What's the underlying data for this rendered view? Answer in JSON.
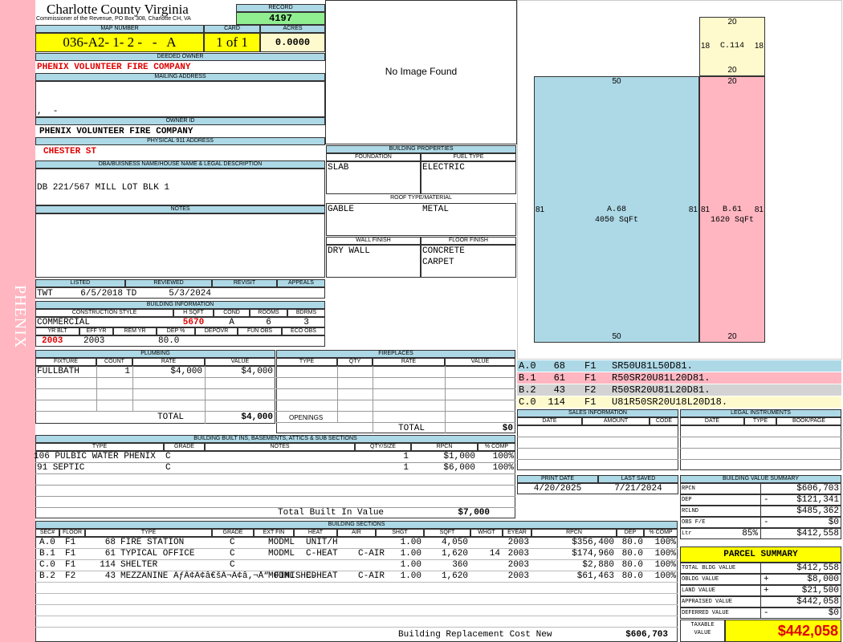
{
  "sidebar": {
    "label": "PHENIX"
  },
  "header": {
    "county": "Charlotte County Virginia",
    "commissioner": "Commissioner of the Revenue, PO Box 308, Charlotte CH, VA",
    "record_label": "RECORD",
    "record": "4197"
  },
  "parcel": {
    "map_label": "MAP NUMBER",
    "map_number": "036-A2- 1- 2 -   -   A",
    "card_label": "CARD",
    "card": "1 of 1",
    "acres_label": "ACRES",
    "acres": "0.0000",
    "deeded_label": "DEEDED OWNER",
    "deeded_owner": "PHENIX VOLUNTEER FIRE COMPANY",
    "mailing_label": "MAILING ADDRESS",
    "mailing_line": ",  -",
    "owner_id_label": "OWNER ID",
    "owner_id": "PHENIX VOLUNTEER FIRE COMPANY",
    "physical_label": "PHYSICAL 911 ADDRESS",
    "physical": "CHESTER ST",
    "dba_label": "DBA/BUISNESS NAME/HOUSE NAME & LEGAL DESCRIPTION",
    "legal": "DB 221/567 MILL LOT BLK 1",
    "notes_label": "NOTES"
  },
  "image": {
    "no_image": "No Image Found"
  },
  "listing": {
    "listed_label": "LISTED",
    "listed_by": "TWT",
    "listed_date": "6/5/2018",
    "reviewed_label": "REVIEWED",
    "reviewed_by": "TD",
    "reviewed_date": "5/3/2024",
    "revisit_label": "REVISIT",
    "appeals_label": "APPEALS"
  },
  "bldg_info": {
    "title": "BUILDING INFORMATION",
    "construction_label": "CONSTRUCTION STYLE",
    "hsqft_label": "H SQFT",
    "cond_label": "COND",
    "rooms_label": "ROOMS",
    "bdrms_label": "BDRMS",
    "construction": "COMMERCIAL",
    "hsqft": "5670",
    "cond": "A",
    "rooms": "6",
    "bdrms": "3",
    "yrblt_label": "YR BLT",
    "effyr_label": "EFF YR",
    "remyr_label": "REM YR",
    "dep_label": "DEP %",
    "depovr_label": "DEPOVR",
    "funobs_label": "FUN OBS",
    "ecoobs_label": "ECO OBS",
    "yrblt": "2003",
    "effyr": "2003",
    "dep": "80.0"
  },
  "props": {
    "title": "BUILDING PROPERTIES",
    "foundation_label": "FOUNDATION",
    "fuel_label": "FUEL TYPE",
    "foundation": "SLAB",
    "fuel": "ELECTRIC",
    "roof_label": "ROOF TYPE/MATERIAL",
    "roof_type": "GABLE",
    "roof_material": "METAL",
    "wall_label": "WALL FINISH",
    "floor_label": "FLOOR FINISH",
    "wall": "DRY WALL",
    "floor1": "CONCRETE",
    "floor2": "CARPET"
  },
  "plumbing": {
    "title": "PLUMBING",
    "fixture_label": "FIXTURE",
    "count_label": "COUNT",
    "rate_label": "RATE",
    "value_label": "VALUE",
    "fixture": "FULLBATH",
    "count": "1",
    "rate": "$4,000",
    "value": "$4,000",
    "total_label": "TOTAL",
    "total": "$4,000"
  },
  "fireplaces": {
    "title": "FIREPLACES",
    "type_label": "TYPE",
    "qty_label": "QTY",
    "rate_label": "RATE",
    "value_label": "VALUE",
    "openings_label": "OPENINGS",
    "total_label": "TOTAL",
    "total": "$0"
  },
  "builtins": {
    "title": "BUILDING BUILT INS, BASEMENTS, ATTICS & SUB SECTIONS",
    "type_label": "TYPE",
    "grade_label": "GRADE",
    "notes_label": "NOTES",
    "qty_label": "QTY/SIZE",
    "rpcn_label": "RPCN",
    "comp_label": "% COMP",
    "rows": [
      {
        "type": "106 PULBIC WATER PHENIX",
        "grade": "C",
        "qty": "1",
        "rpcn": "$1,000",
        "comp": "100%"
      },
      {
        "type": "91 SEPTIC",
        "grade": "C",
        "qty": "1",
        "rpcn": "$6,000",
        "comp": "100%"
      }
    ],
    "total_label": "Total Built In Value",
    "total": "$7,000"
  },
  "sections": {
    "title": "BUILDING SECTIONS",
    "cols": [
      "SEC#",
      "FLOOR",
      "TYPE",
      "GRADE",
      "EXT FIN",
      "HEAT",
      "AIR",
      "SHGT",
      "SQFT",
      "WHGT",
      "EYEAR",
      "RPCN",
      "DEP",
      "% COMP"
    ],
    "rows": [
      {
        "sec": "A.0",
        "floor": "F1",
        "code": "68",
        "type": "FIRE STATION",
        "grade": "C",
        "ext": "MODML",
        "heat": "UNIT/H",
        "air": "",
        "shgt": "1.00",
        "sqft": "4,050",
        "whgt": "",
        "eyear": "2003",
        "rpcn": "$356,400",
        "dep": "80.0",
        "comp": "100%"
      },
      {
        "sec": "B.1",
        "floor": "F1",
        "code": "61",
        "type": "TYPICAL OFFICE",
        "grade": "C",
        "ext": "MODML",
        "heat": "C-HEAT",
        "air": "C-AIR",
        "shgt": "1.00",
        "sqft": "1,620",
        "whgt": "14",
        "eyear": "2003",
        "rpcn": "$174,960",
        "dep": "80.0",
        "comp": "100%"
      },
      {
        "sec": "C.0",
        "floor": "F1",
        "code": "114",
        "type": "SHELTER",
        "grade": "C",
        "ext": "",
        "heat": "",
        "air": "",
        "shgt": "1.00",
        "sqft": "360",
        "whgt": "",
        "eyear": "2003",
        "rpcn": "$2,880",
        "dep": "80.0",
        "comp": "100%"
      },
      {
        "sec": "B.2",
        "floor": "F2",
        "code": "43",
        "type": "MEZZANINE ÃƒÂ¢Ã¢â€šÂ¬Ã¢â‚¬Å“ FINISHED",
        "grade": "",
        "ext": "MODML",
        "heat": "C-HEAT",
        "air": "C-AIR",
        "shgt": "1.00",
        "sqft": "1,620",
        "whgt": "",
        "eyear": "2003",
        "rpcn": "$61,463",
        "dep": "80.0",
        "comp": "100%"
      }
    ],
    "total_label": "Building Replacement Cost New",
    "total": "$606,703"
  },
  "sketch": {
    "rect_a": {
      "top": "50",
      "bottom": "50",
      "left": "81",
      "right": "81",
      "label": "A.68",
      "sqft": "4050 SqFt"
    },
    "rect_b": {
      "top": "20",
      "bottom": "20",
      "left": "81",
      "right": "81",
      "label": "B.61",
      "sqft": "1620 SqFt"
    },
    "rect_c": {
      "top": "20",
      "bottom": "20",
      "left": "18",
      "right": "18",
      "label": "C.114"
    }
  },
  "sketch_legend": [
    {
      "sec": "A.0",
      "code": "68",
      "floor": "F1",
      "path": "SR50U81L50D81.",
      "color": "#add8e6"
    },
    {
      "sec": "B.1",
      "code": "61",
      "floor": "F1",
      "path": "R50SR20U81L20D81.",
      "color": "#ffb6c1"
    },
    {
      "sec": "B.2",
      "code": "43",
      "floor": "F2",
      "path": "R50SR20U81L20D81.",
      "color": "#d3d3d3"
    },
    {
      "sec": "C.0",
      "code": "114",
      "floor": "F1",
      "path": "U81R50SR20U18L20D18.",
      "color": "#fffacd"
    }
  ],
  "sales": {
    "title": "SALES INFORMATION",
    "date_label": "DATE",
    "amount_label": "AMOUNT",
    "code_label": "CODE"
  },
  "legal": {
    "title": "LEGAL INSTRUMENTS",
    "date_label": "DATE",
    "type_label": "TYPE",
    "book_label": "BOOK/PAGE"
  },
  "dates": {
    "print_label": "PRINT DATE",
    "print": "4/20/2025",
    "saved_label": "LAST SAVED",
    "saved": "7/21/2024"
  },
  "value_summary": {
    "title": "BUILDING VALUE SUMMARY",
    "rows": [
      {
        "label": "RPCN",
        "sign": "",
        "pct": "",
        "value": "$606,703"
      },
      {
        "label": "DEP",
        "sign": "-",
        "pct": "",
        "value": "$121,341"
      },
      {
        "label": "RCLND",
        "sign": "",
        "pct": "",
        "value": "$485,362"
      },
      {
        "label": "OBS F/E",
        "sign": "-",
        "pct": "",
        "value": "$0"
      },
      {
        "label": "Ltr",
        "sign": "",
        "pct": "85%",
        "value": "$412,558"
      }
    ]
  },
  "parcel_summary": {
    "title": "PARCEL SUMMARY",
    "rows": [
      {
        "label": "TOTAL BLDG VALUE",
        "sign": "",
        "value": "$412,558"
      },
      {
        "label": "OBLDG VALUE",
        "sign": "+",
        "value": "$8,000"
      },
      {
        "label": "LAND VALUE",
        "sign": "+",
        "value": "$21,500"
      },
      {
        "label": "APPRAISED VALUE",
        "sign": "",
        "value": "$442,058"
      },
      {
        "label": "DEFERRED VALUE",
        "sign": "-",
        "value": "$0"
      }
    ],
    "taxable_label1": "TAXABLE",
    "taxable_label2": "VALUE",
    "taxable": "$442,058"
  }
}
